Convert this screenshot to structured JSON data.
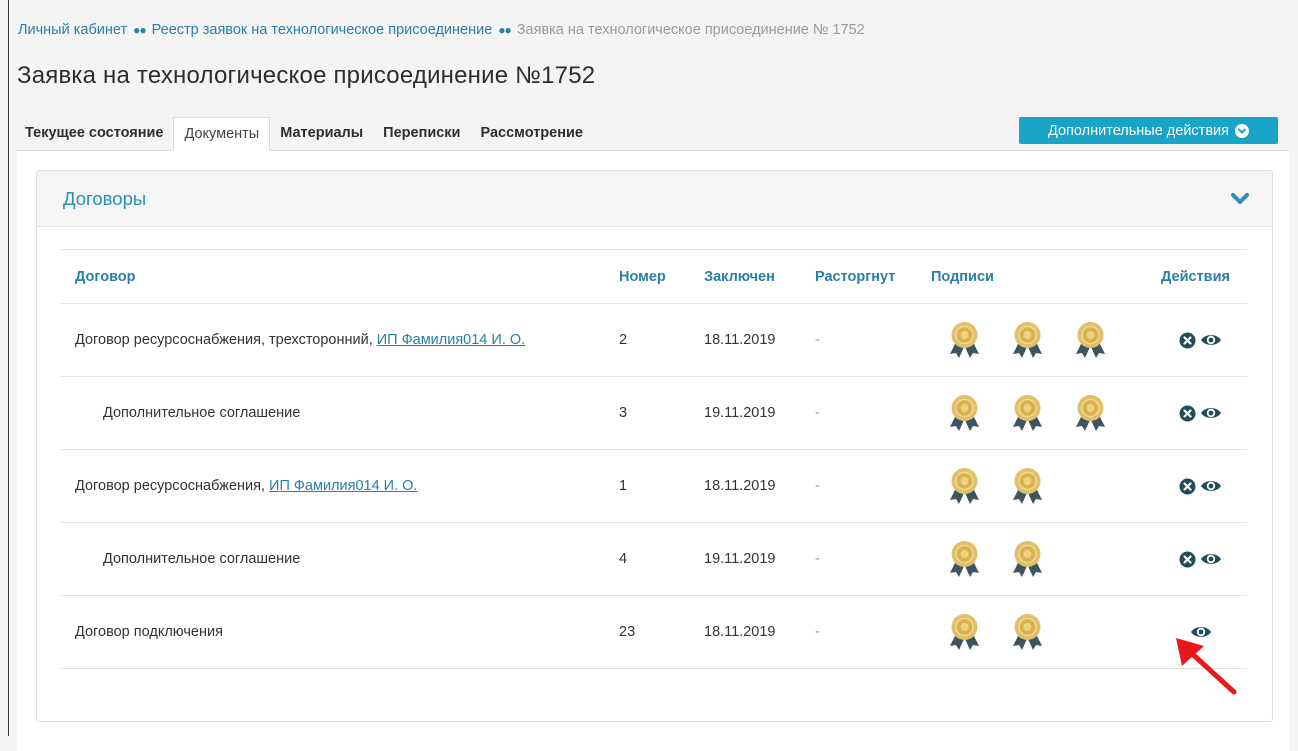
{
  "breadcrumb": {
    "items": [
      {
        "label": "Личный кабинет"
      },
      {
        "label": "Реестр заявок на технологическое присоединение"
      }
    ],
    "current": "Заявка на технологическое присоединение № 1752"
  },
  "page_title": "Заявка на технологическое присоединение №1752",
  "tabs": [
    {
      "label": "Текущее состояние",
      "active": false
    },
    {
      "label": "Документы",
      "active": true
    },
    {
      "label": "Материалы",
      "active": false
    },
    {
      "label": "Переписки",
      "active": false
    },
    {
      "label": "Рассмотрение",
      "active": false
    }
  ],
  "actions_button": {
    "label": "Дополнительные действия"
  },
  "card": {
    "title": "Договоры"
  },
  "table": {
    "headers": {
      "name": "Договор",
      "number": "Номер",
      "concluded": "Заключен",
      "terminated": "Расторгнут",
      "signatures": "Подписи",
      "actions": "Действия"
    },
    "rows": [
      {
        "name": "Договор ресурсоснабжения, трехсторонний,",
        "link": "ИП Фамилия014 И. О.",
        "number": "2",
        "concluded": "18.11.2019",
        "terminated": "-",
        "signatures": 3,
        "indent": false,
        "delete": true
      },
      {
        "name": "Дополнительное соглашение",
        "link": "",
        "number": "3",
        "concluded": "19.11.2019",
        "terminated": "-",
        "signatures": 3,
        "indent": true,
        "delete": true
      },
      {
        "name": "Договор ресурсоснабжения,",
        "link": "ИП Фамилия014 И. О.",
        "number": "1",
        "concluded": "18.11.2019",
        "terminated": "-",
        "signatures": 2,
        "indent": false,
        "delete": true
      },
      {
        "name": "Дополнительное соглашение",
        "link": "",
        "number": "4",
        "concluded": "19.11.2019",
        "terminated": "-",
        "signatures": 2,
        "indent": true,
        "delete": true
      },
      {
        "name": "Договор подключения",
        "link": "",
        "number": "23",
        "concluded": "18.11.2019",
        "terminated": "-",
        "signatures": 2,
        "indent": false,
        "delete": false
      }
    ]
  },
  "colors": {
    "accent": "#17a4c6",
    "link": "#2a7fa5",
    "icon_dark": "#1f4e5a",
    "seal_gold": "#e2c06a",
    "ribbon": "#3d5560",
    "arrow": "#e8191b"
  },
  "icons": {
    "delete": "circle-x-icon",
    "view": "eye-icon",
    "signature": "seal-icon",
    "collapse": "chevron-down-icon"
  }
}
